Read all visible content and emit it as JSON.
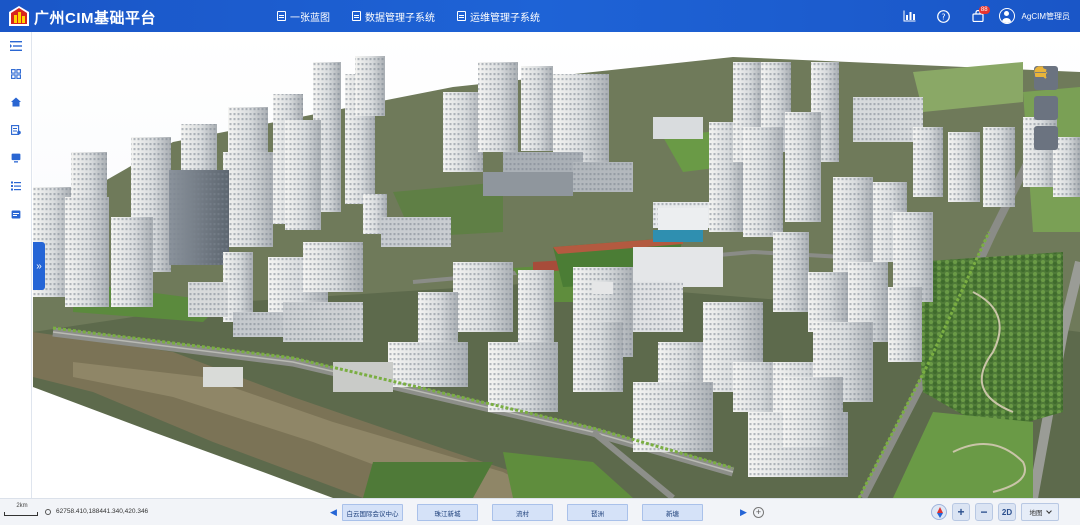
{
  "header": {
    "title": "广州CIM基础平台",
    "nav": [
      {
        "label": "一张蓝图",
        "icon": "blueprint-icon"
      },
      {
        "label": "数据管理子系统",
        "icon": "document-icon"
      },
      {
        "label": "运维管理子系统",
        "icon": "document-icon"
      }
    ],
    "notification_count": "88",
    "user_name": "AgCIM管理员"
  },
  "sidebar": {
    "items": [
      {
        "icon": "collapse-menu-icon"
      },
      {
        "icon": "apps-grid-icon"
      },
      {
        "icon": "home-icon"
      },
      {
        "icon": "layers-icon"
      },
      {
        "icon": "monitor-icon"
      },
      {
        "icon": "list-icon"
      },
      {
        "icon": "calendar-icon"
      }
    ],
    "expand_glyph": "»"
  },
  "right_tools": [
    {
      "icon": "layers-icon"
    },
    {
      "icon": "search-icon"
    },
    {
      "icon": "toolbox-icon"
    }
  ],
  "footer": {
    "scale_label": "2km",
    "coordinates": "62758.410,188441.340,420.346",
    "prev_arrow": "◀",
    "next_arrow": "▶",
    "locations": [
      "白云国际会议中心",
      "珠江新城",
      "流村",
      "琶洲",
      "新塘"
    ],
    "add_glyph": "+",
    "zoom_in": "+",
    "zoom_out": "−",
    "view_mode": "2D",
    "basemap": "地图"
  },
  "colors": {
    "header_bg": "#1e63d6",
    "accent": "#2565d6",
    "tool_bg": "#6b7380",
    "tool_glyph": "#e9b43b"
  }
}
